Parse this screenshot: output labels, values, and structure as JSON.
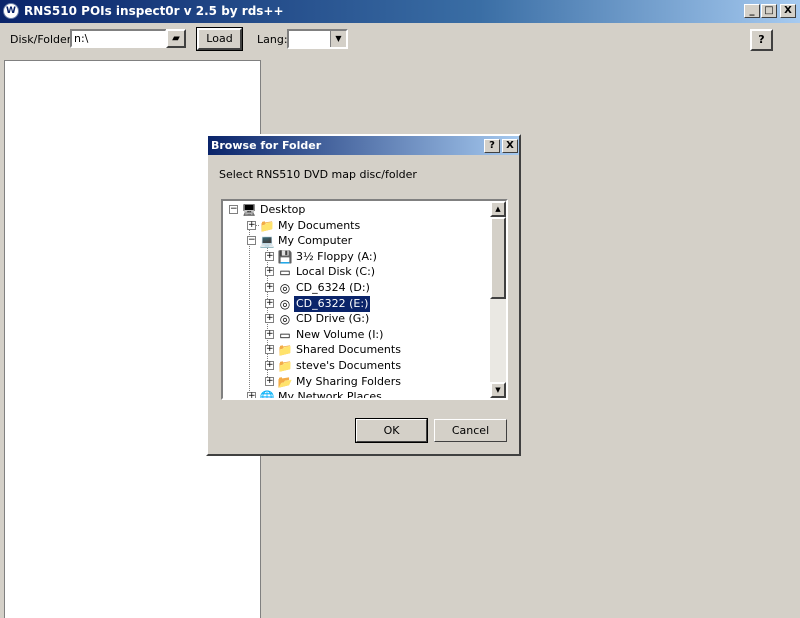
{
  "window": {
    "title": "RNS510 POIs inspect0r v 2.5 by rds++",
    "logo_text": "W",
    "minimize": "_",
    "maximize": "□",
    "close": "X"
  },
  "toolbar": {
    "disk_folder_label": "Disk/Folder:",
    "disk_folder_value": "n:\\",
    "load_label": "Load",
    "lang_label": "Lang:",
    "lang_value": "",
    "help_label": "?"
  },
  "dialog": {
    "title": "Browse for Folder",
    "help": "?",
    "close": "X",
    "instruction": "Select RNS510 DVD map disc/folder",
    "ok_label": "OK",
    "cancel_label": "Cancel",
    "tree": [
      {
        "label": "Desktop",
        "icon": "desktop-icon",
        "glyph": "🖥",
        "expander": "−"
      },
      {
        "label": "My Documents",
        "icon": "folder-icon",
        "glyph": "📁",
        "expander": "+"
      },
      {
        "label": "My Computer",
        "icon": "computer-icon",
        "glyph": "💻",
        "expander": "−"
      },
      {
        "label": "3½ Floppy (A:)",
        "icon": "floppy-drive-icon",
        "glyph": "💾",
        "expander": "+"
      },
      {
        "label": "Local Disk (C:)",
        "icon": "hard-disk-icon",
        "glyph": "▭",
        "expander": "+"
      },
      {
        "label": "CD_6324 (D:)",
        "icon": "cd-icon",
        "glyph": "◎",
        "expander": "+"
      },
      {
        "label": "CD_6322 (E:)",
        "icon": "cd-icon",
        "glyph": "◎",
        "expander": "+"
      },
      {
        "label": "CD Drive (G:)",
        "icon": "cd-drive-icon",
        "glyph": "◎",
        "expander": "+"
      },
      {
        "label": "New Volume (I:)",
        "icon": "hard-disk-icon",
        "glyph": "▭",
        "expander": "+"
      },
      {
        "label": "Shared Documents",
        "icon": "folder-icon",
        "glyph": "📁",
        "expander": "+"
      },
      {
        "label": "steve's Documents",
        "icon": "folder-icon",
        "glyph": "📁",
        "expander": "+"
      },
      {
        "label": "My Sharing Folders",
        "icon": "sharing-folder-icon",
        "glyph": "📂",
        "expander": "+"
      },
      {
        "label": "My Network Places",
        "icon": "network-icon",
        "glyph": "🌐",
        "expander": "+"
      }
    ],
    "scroll_up": "▲",
    "scroll_down": "▼"
  }
}
